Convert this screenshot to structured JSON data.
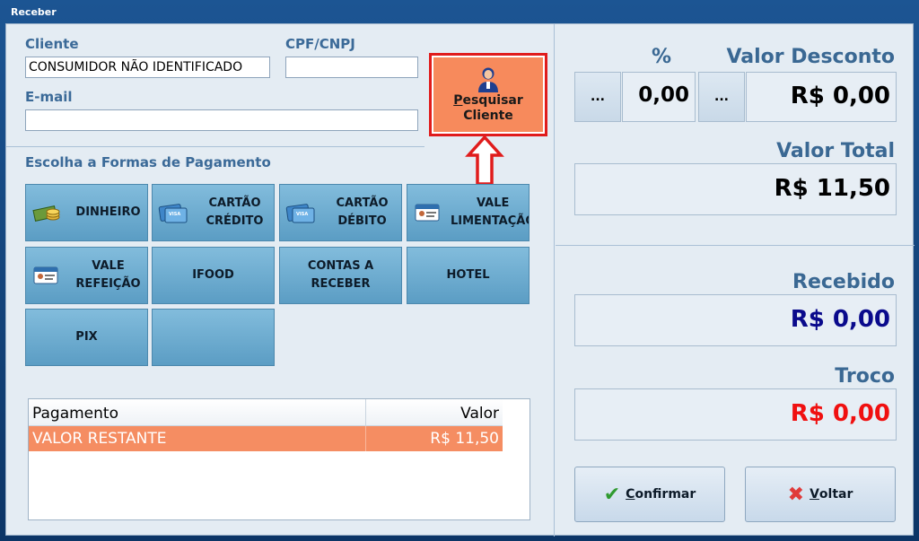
{
  "window": {
    "title": "Receber"
  },
  "cliente": {
    "label": "Cliente",
    "value": "CONSUMIDOR NÃO IDENTIFICADO"
  },
  "cpf": {
    "label": "CPF/CNPJ",
    "value": ""
  },
  "email": {
    "label": "E-mail",
    "value": ""
  },
  "search_button": {
    "label_underlined": "P",
    "label_line1_rest": "esquisar",
    "label_line2": "Cliente"
  },
  "payment_section": {
    "title": "Escolha a Formas de Pagamento"
  },
  "payment_buttons": [
    {
      "line1": "DINHEIRO",
      "line2": "",
      "icon": "cash-icon"
    },
    {
      "line1": "CARTÃO",
      "line2": "CRÉDITO",
      "icon": "credit-card-icon"
    },
    {
      "line1": "CARTÃO",
      "line2": "DÉBITO",
      "icon": "debit-card-icon"
    },
    {
      "line1": "VALE",
      "line2": "LIMENTAÇÃO",
      "icon": "voucher-card-icon"
    },
    {
      "line1": "VALE",
      "line2": "REFEIÇÃO",
      "icon": "voucher-card-icon"
    },
    {
      "line1": "IFOOD",
      "line2": ""
    },
    {
      "line1": "CONTAS A",
      "line2": "RECEBER"
    },
    {
      "line1": "HOTEL",
      "line2": ""
    },
    {
      "line1": "PIX",
      "line2": ""
    },
    {
      "line1": "",
      "line2": ""
    }
  ],
  "payments_table": {
    "columns": [
      "Pagamento",
      "Valor"
    ],
    "rows": [
      {
        "pagamento": "VALOR RESTANTE",
        "valor": "R$ 11,50"
      }
    ]
  },
  "discount": {
    "percent_label": "%",
    "percent_value": "0,00",
    "value_label": "Valor Desconto",
    "value": "R$ 0,00",
    "ellipsis": "..."
  },
  "total": {
    "label": "Valor Total",
    "value": "R$ 11,50"
  },
  "received": {
    "label": "Recebido",
    "value": "R$ 0,00",
    "color": "#0a0a8c"
  },
  "change": {
    "label": "Troco",
    "value": "R$ 0,00",
    "color": "#f01010"
  },
  "actions": {
    "confirm": {
      "underlined": "C",
      "rest": "onfirmar"
    },
    "back": {
      "underlined": "V",
      "rest": "oltar"
    }
  },
  "colors": {
    "accent_orange": "#f78a5c",
    "highlight_red": "#e01c1c",
    "button_blue": "#6aa9cf"
  }
}
